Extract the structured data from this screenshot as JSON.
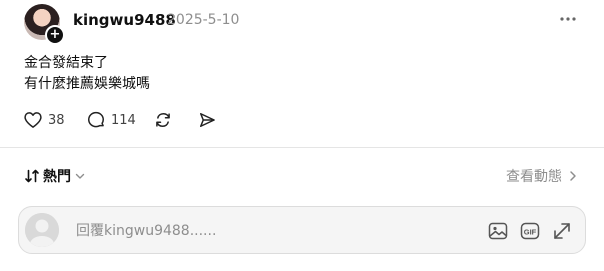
{
  "post": {
    "author": "kingwu9488",
    "timestamp": "2025-5-10",
    "follow_badge": "+",
    "body_line1": "金合發結束了",
    "body_line2": "有什麼推薦娛樂城嗎"
  },
  "actions": {
    "like_count": "38",
    "comment_count": "114"
  },
  "sort": {
    "label": "熱門",
    "view_activity": "查看動態"
  },
  "reply": {
    "placeholder": "回覆kingwu9488......"
  },
  "colors": {
    "text": "#101010",
    "muted": "#8e8e8e",
    "divider": "#e5e5e5",
    "reply_bg": "#f5f5f5"
  },
  "icons": [
    "more-icon",
    "heart-icon",
    "comment-icon",
    "repost-icon",
    "share-icon",
    "sort-icon",
    "chevron-down-icon",
    "chevron-right-icon",
    "image-icon",
    "gif-icon",
    "expand-icon"
  ]
}
